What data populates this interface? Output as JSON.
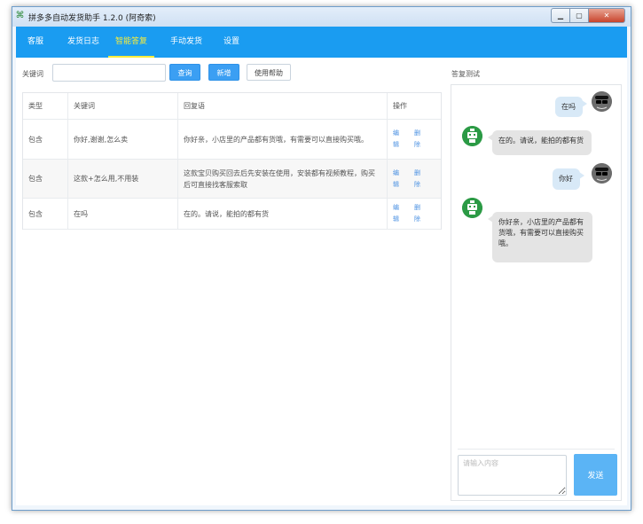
{
  "window": {
    "title": "拼多多自动发货助手 1.2.0 (阿奇索)"
  },
  "nav": {
    "items": [
      {
        "label": "客服"
      },
      {
        "label": "发货日志"
      },
      {
        "label": "智能答复"
      },
      {
        "label": "手动发货"
      },
      {
        "label": "设置"
      }
    ],
    "active_index": 2
  },
  "search": {
    "label": "关键词",
    "value": "",
    "query_button": "查询",
    "add_button": "新增",
    "help_button": "使用帮助"
  },
  "table": {
    "headers": [
      "类型",
      "关键词",
      "回复语",
      "操作"
    ],
    "rows": [
      {
        "type": "包含",
        "keyword": "你好,谢谢,怎么卖",
        "reply": "你好亲，小店里的产品都有货哦，有需要可以直接购买哦。",
        "edit": "编辑",
        "delete": "删除"
      },
      {
        "type": "包含",
        "keyword": "这款+怎么用,不用装",
        "reply": "这款宝贝购买回去后先安装在使用，安装都有视频教程，购买后可直接找客服索取",
        "edit": "编辑",
        "delete": "删除"
      },
      {
        "type": "包含",
        "keyword": "在吗",
        "reply": "在的。请说，能拍的都有货",
        "edit": "编辑",
        "delete": "删除"
      }
    ]
  },
  "chat": {
    "title": "答复测试",
    "messages": [
      {
        "from": "user",
        "text": "在吗"
      },
      {
        "from": "bot",
        "text": "在的。请说，能拍的都有货"
      },
      {
        "from": "user",
        "text": "你好"
      },
      {
        "from": "bot",
        "text": "你好亲，小店里的产品都有货哦，有需要可以直接购买哦。"
      }
    ],
    "input_placeholder": "请输入内容",
    "send_button": "发送"
  },
  "colors": {
    "nav_bg": "#1a9cf1",
    "nav_active": "#f8ec3b",
    "primary_button": "#3b9ff3",
    "send_button": "#5bb4f5",
    "link": "#4a90e2",
    "bot_avatar": "#2b9a45"
  }
}
